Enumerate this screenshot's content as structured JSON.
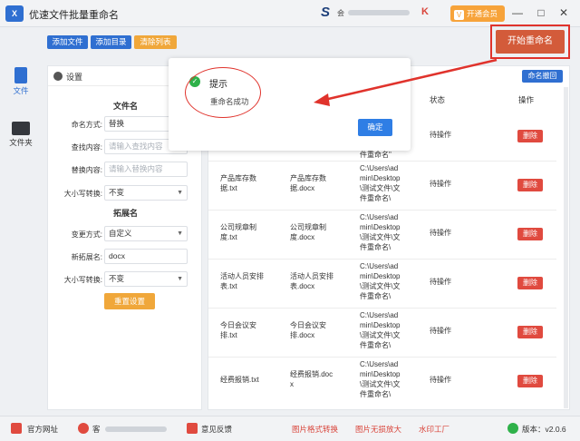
{
  "app": {
    "title": "优速文件批量重命名",
    "logo_text": "X"
  },
  "titlebar": {
    "user_initial": "S",
    "user_name": "会",
    "vip_label": "开通会员",
    "win_minimize": "—",
    "win_restore": "□",
    "win_close": "✕"
  },
  "toolbar": {
    "add_file": "添加文件",
    "add_dir": "添加目录",
    "clear_list": "清除列表",
    "start_rename": "开始重命名"
  },
  "rail": {
    "file": "文件",
    "folder": "文件夹"
  },
  "settings": {
    "header": "设置",
    "filename_section": "文件名",
    "rename_mode_label": "命名方式:",
    "rename_mode_value": "替换",
    "find_label": "查找内容:",
    "find_placeholder": "请输入查找内容",
    "replace_label": "替换内容:",
    "replace_placeholder": "请输入替换内容",
    "case_label": "大小写转换:",
    "case_value": "不变",
    "ext_section": "拓展名",
    "change_mode_label": "变更方式:",
    "change_mode_value": "自定义",
    "new_ext_label": "新拓展名:",
    "new_ext_value": "docx",
    "ext_case_label": "大小写转换:",
    "ext_case_value": "不变",
    "reset_label": "重置设置"
  },
  "table": {
    "undo_label": "命名撤回",
    "headers": {
      "status": "状态",
      "action": "操作"
    },
    "rows": [
      {
        "orig1": "",
        "orig2": "",
        "new1": "",
        "new2": "",
        "path1": "",
        "path2": "",
        "path3": "件重命名\"",
        "status": "待操作",
        "action": "删除"
      },
      {
        "orig1": "产品库存数",
        "orig2": "据.txt",
        "new1": "产品库存数",
        "new2": "据.docx",
        "path1": "C:\\Users\\ad",
        "path2": "min\\Desktop",
        "path3": "\\测试文件\\文",
        "path4": "件重命名\\",
        "status": "待操作",
        "action": "删除"
      },
      {
        "orig1": "公司规章制",
        "orig2": "度.txt",
        "new1": "公司规章制",
        "new2": "度.docx",
        "path1": "C:\\Users\\ad",
        "path2": "min\\Desktop",
        "path3": "\\测试文件\\文",
        "path4": "件重命名\\",
        "status": "待操作",
        "action": "删除"
      },
      {
        "orig1": "活动人员安排",
        "orig2": "表.txt",
        "new1": "活动人员安排",
        "new2": "表.docx",
        "path1": "C:\\Users\\ad",
        "path2": "min\\Desktop",
        "path3": "\\测试文件\\文",
        "path4": "件重命名\\",
        "status": "待操作",
        "action": "删除"
      },
      {
        "orig1": "今日会议安",
        "orig2": "排.txt",
        "new1": "今日会议安",
        "new2": "排.docx",
        "path1": "C:\\Users\\ad",
        "path2": "min\\Desktop",
        "path3": "\\测试文件\\文",
        "path4": "件重命名\\",
        "status": "待操作",
        "action": "删除"
      },
      {
        "orig1": "经费报销.txt",
        "orig2": "",
        "new1": "经费报销.doc",
        "new2": "x",
        "path1": "C:\\Users\\ad",
        "path2": "min\\Desktop",
        "path3": "\\测试文件\\文",
        "path4": "件重命名\\",
        "status": "待操作",
        "action": "删除"
      }
    ]
  },
  "modal": {
    "title": "提示",
    "message": "重命名成功",
    "ok_label": "确定"
  },
  "footer": {
    "website": "官方网址",
    "service": "客",
    "feedback": "意见反馈",
    "img_convert": "图片格式转换",
    "img_enlarge": "图片无损放大",
    "watermark": "水印工厂",
    "version": "版本：v2.0.6"
  },
  "colors": {
    "primary": "#2f6fd1",
    "orange": "#f0a73a",
    "danger": "#e04a3f",
    "start": "#d35b3a",
    "annotation_red": "#e0332c",
    "success": "#2fb14a"
  }
}
